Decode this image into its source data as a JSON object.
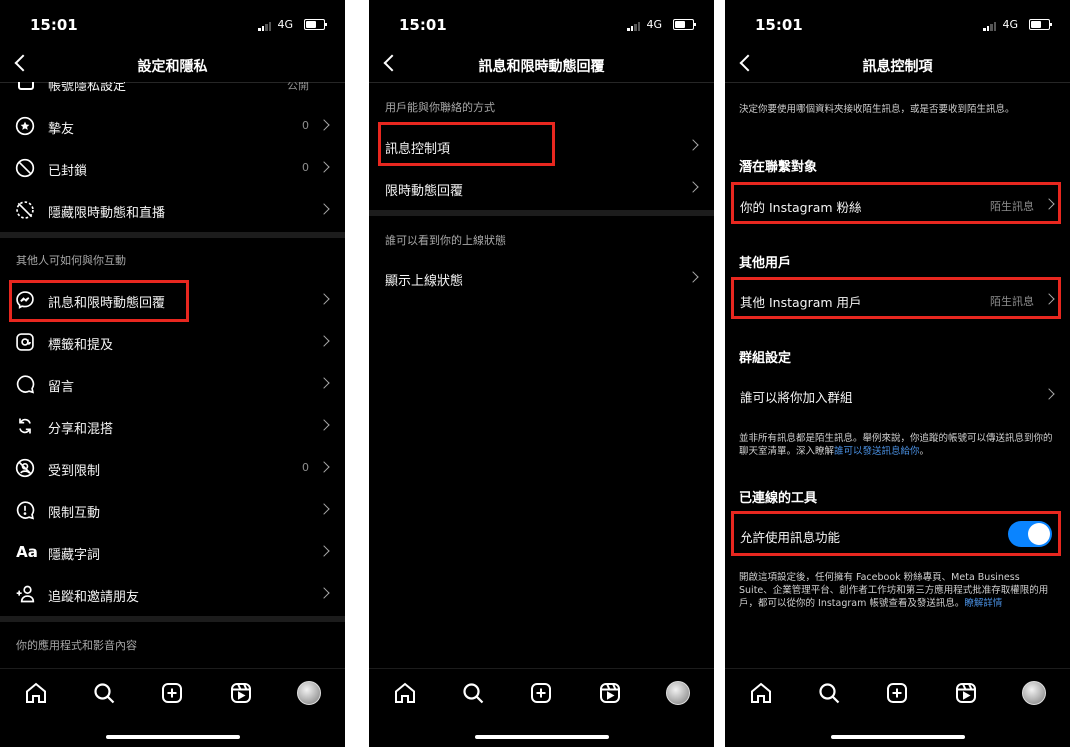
{
  "status": {
    "time": "15:01",
    "network": "4G"
  },
  "phone1": {
    "title": "設定和隱私",
    "partial_row": {
      "label": "帳號隱私設定",
      "value": "公開"
    },
    "rows_top": [
      {
        "label": "摯友",
        "count": "0"
      },
      {
        "label": "已封鎖",
        "count": "0"
      },
      {
        "label": "隱藏限時動態和直播",
        "count": ""
      }
    ],
    "section2": "其他人可如何與你互動",
    "rows_bottom": [
      {
        "label": "訊息和限時動態回覆",
        "count": ""
      },
      {
        "label": "標籤和提及",
        "count": ""
      },
      {
        "label": "留言",
        "count": ""
      },
      {
        "label": "分享和混搭",
        "count": ""
      },
      {
        "label": "受到限制",
        "count": "0"
      },
      {
        "label": "限制互動",
        "count": ""
      },
      {
        "label": "隱藏字詞",
        "count": ""
      },
      {
        "label": "追蹤和邀請朋友",
        "count": ""
      }
    ],
    "section3": "你的應用程式和影音內容"
  },
  "phone2": {
    "title": "訊息和限時動態回覆",
    "section1": "用戶能與你聯絡的方式",
    "rows1": [
      {
        "label": "訊息控制項"
      },
      {
        "label": "限時動態回覆"
      }
    ],
    "section2": "誰可以看到你的上線狀態",
    "rows2": [
      {
        "label": "顯示上線狀態"
      }
    ]
  },
  "phone3": {
    "title": "訊息控制項",
    "intro": "決定你要使用哪個資料夾接收陌生訊息，或是否要收到陌生訊息。",
    "head_potential": "潛在聯繫對象",
    "row_followers": {
      "label": "你的 Instagram 粉絲",
      "value": "陌生訊息"
    },
    "head_others": "其他用戶",
    "row_others": {
      "label": "其他 Instagram 用戶",
      "value": "陌生訊息"
    },
    "head_groups": "群組設定",
    "row_groups": {
      "label": "誰可以將你加入群組"
    },
    "note1": "並非所有訊息都是陌生訊息。舉例來說，你追蹤的帳號可以傳送訊息到你的聊天室清單。深入瞭解",
    "note1_link": "誰可以發送訊息給你",
    "note1_end": "。",
    "head_tools": "已連線的工具",
    "row_allow": {
      "label": "允許使用訊息功能",
      "enabled": true
    },
    "note2": "開啟這項設定後，任何擁有 Facebook 粉絲專頁、Meta Business Suite、企業管理平台、創作者工作坊和第三方應用程式批准存取權限的用戶，都可以從你的 Instagram 帳號查看及發送訊息。",
    "note2_link": "瞭解詳情"
  },
  "tabs": [
    "home-icon",
    "search-icon",
    "create-icon",
    "reels-icon",
    "profile-avatar"
  ],
  "colors": {
    "background": "#000000",
    "highlight": "#e8271f",
    "toggle_on": "#0a84ff",
    "link": "#4a90e2"
  }
}
